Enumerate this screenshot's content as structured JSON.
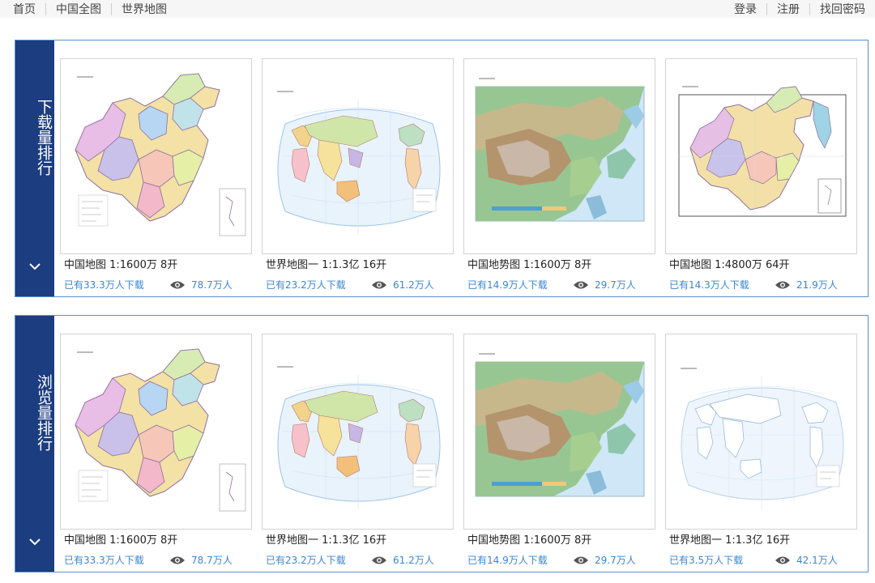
{
  "nav": {
    "items": [
      "首页",
      "中国全图",
      "世界地图"
    ]
  },
  "auth": {
    "items": [
      "登录",
      "注册",
      "找回密码"
    ]
  },
  "sections": [
    {
      "label": "下载量排行",
      "cards": [
        {
          "title": "中国地图 1:1600万 8开",
          "downloads": "已有33.3万人下载",
          "views": "78.7万人",
          "thumb": "china-political"
        },
        {
          "title": "世界地图一 1:1.3亿 16开",
          "downloads": "已有23.2万人下载",
          "views": "61.2万人",
          "thumb": "world-political"
        },
        {
          "title": "中国地势图 1:1600万 8开",
          "downloads": "已有14.9万人下载",
          "views": "29.7万人",
          "thumb": "china-terrain"
        },
        {
          "title": "中国地图 1:4800万 64开",
          "downloads": "已有14.3万人下载",
          "views": "21.9万人",
          "thumb": "china-political-small"
        }
      ]
    },
    {
      "label": "浏览量排行",
      "cards": [
        {
          "title": "中国地图 1:1600万 8开",
          "downloads": "已有33.3万人下载",
          "views": "78.7万人",
          "thumb": "china-political"
        },
        {
          "title": "世界地图一 1:1.3亿 16开",
          "downloads": "已有23.2万人下载",
          "views": "61.2万人",
          "thumb": "world-political"
        },
        {
          "title": "中国地势图 1:1600万 8开",
          "downloads": "已有14.9万人下载",
          "views": "29.7万人",
          "thumb": "china-terrain"
        },
        {
          "title": "世界地图一 1:1.3亿 16开",
          "downloads": "已有3.5万人下载",
          "views": "42.1万人",
          "thumb": "world-outline"
        }
      ]
    }
  ],
  "colors": {
    "panel_border": "#5a8fd1",
    "side_label_bg": "#1c3d80",
    "stat_text": "#3a86d4",
    "top_bar_bg": "#f6f6f6"
  },
  "icons": {
    "views": "eye-icon",
    "expand": "chevron-down-icon"
  }
}
